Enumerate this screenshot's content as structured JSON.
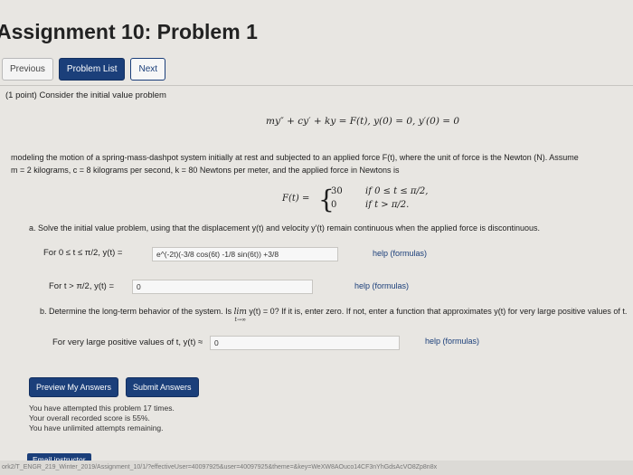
{
  "page": {
    "title": "Assignment 10: Problem 1"
  },
  "nav": {
    "previous": "Previous",
    "problem_list": "Problem List",
    "next": "Next"
  },
  "problem": {
    "intro": "(1 point) Consider the initial value problem",
    "equation": "my″ + cy′ + ky = F(t),   y(0) = 0,   y′(0) = 0",
    "model_line1": "modeling the motion of a spring-mass-dashpot system initially at rest and subjected to an applied force F(t), where the unit of force is the Newton (N). Assume",
    "model_line2": "m = 2 kilograms, c = 8 kilograms per second, k = 80 Newtons per meter, and the applied force in Newtons is",
    "piecewise": {
      "label": "F(t) =",
      "value1": "30",
      "cond1": "if 0 ≤ t ≤ π/2,",
      "value2": "0",
      "cond2": "if t > π/2."
    }
  },
  "part_a": {
    "question": "a. Solve the initial value problem, using that the displacement y(t) and velocity y′(t) remain continuous when the applied force is discontinuous.",
    "row1_label": "For 0 ≤ t ≤ π/2,  y(t) =",
    "row1_value": "e^(-2t)(-3/8 cos(6t) -1/8 sin(6t)) +3/8",
    "row1_help": "help (formulas)",
    "row2_label": "For t > π/2,  y(t) =",
    "row2_value": "0",
    "row2_help": "help (formulas)"
  },
  "part_b": {
    "question_pre": "b. Determine the long-term behavior of the system. Is",
    "lim_word": "lim",
    "lim_sub": "t→∞",
    "question_post": "y(t) = 0? If it is, enter zero. If not, enter a function that approximates y(t) for very large positive values of t.",
    "row_label": "For very large positive values of t,  y(t) ≈",
    "row_value": "0",
    "row_help": "help (formulas)"
  },
  "actions": {
    "preview": "Preview My Answers",
    "submit": "Submit Answers"
  },
  "status": {
    "line1": "You have attempted this problem 17 times.",
    "line2": "Your overall recorded score is 55%.",
    "line3": "You have unlimited attempts remaining."
  },
  "footer": {
    "email": "Email instructor",
    "url": "ork2/T_ENGR_219_Winter_2019/Assignment_10/1/?effectiveUser=40097925&user=40097925&theme=&key=WeXW8AOuco14CF3nYhGdsAcVO8Zp8n8x"
  },
  "colors": {
    "primary": "#1b3f7a",
    "background": "#e8e6e2"
  }
}
